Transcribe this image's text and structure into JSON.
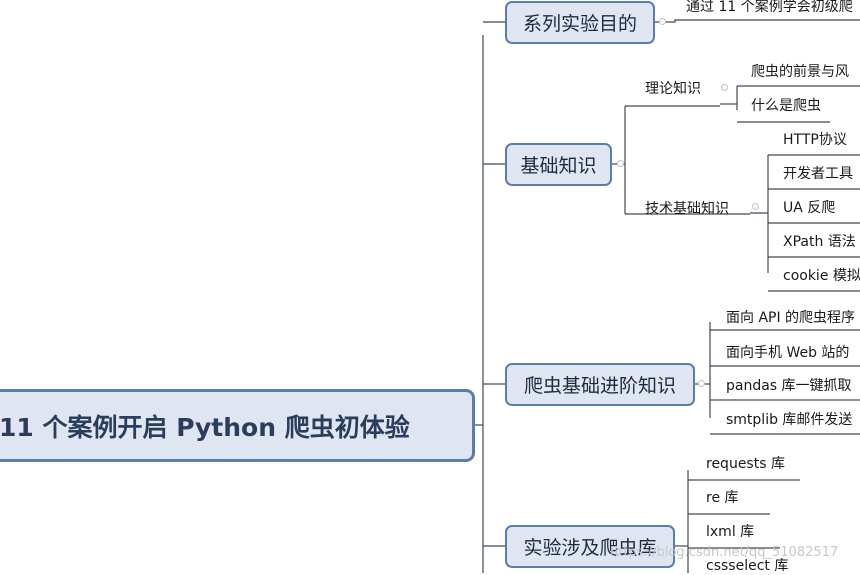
{
  "root": {
    "label": "11 个案例开启 Python 爬虫初体验"
  },
  "branches": [
    {
      "label": "系列实验目的",
      "children": [
        {
          "label": "通过 11 个案例学会初级爬"
        }
      ]
    },
    {
      "label": "基础知识",
      "groups": [
        {
          "label": "理论知识",
          "children": [
            {
              "label": "爬虫的前景与风"
            },
            {
              "label": "什么是爬虫"
            }
          ]
        },
        {
          "label": "技术基础知识",
          "children": [
            {
              "label": "HTTP协议"
            },
            {
              "label": "开发者工具"
            },
            {
              "label": "UA 反爬"
            },
            {
              "label": "XPath 语法"
            },
            {
              "label": "cookie 模拟"
            }
          ]
        }
      ]
    },
    {
      "label": "爬虫基础进阶知识",
      "children": [
        {
          "label": "面向 API 的爬虫程序"
        },
        {
          "label": "面向手机 Web 站的"
        },
        {
          "label": "pandas 库一键抓取"
        },
        {
          "label": "smtplib  库邮件发送"
        }
      ]
    },
    {
      "label": "实验涉及爬虫库",
      "children": [
        {
          "label": "requests 库"
        },
        {
          "label": "re 库"
        },
        {
          "label": "lxml 库"
        },
        {
          "label": "cssselect 库"
        }
      ]
    }
  ],
  "watermark": "https://blog.csdn.net/qq_51082517"
}
